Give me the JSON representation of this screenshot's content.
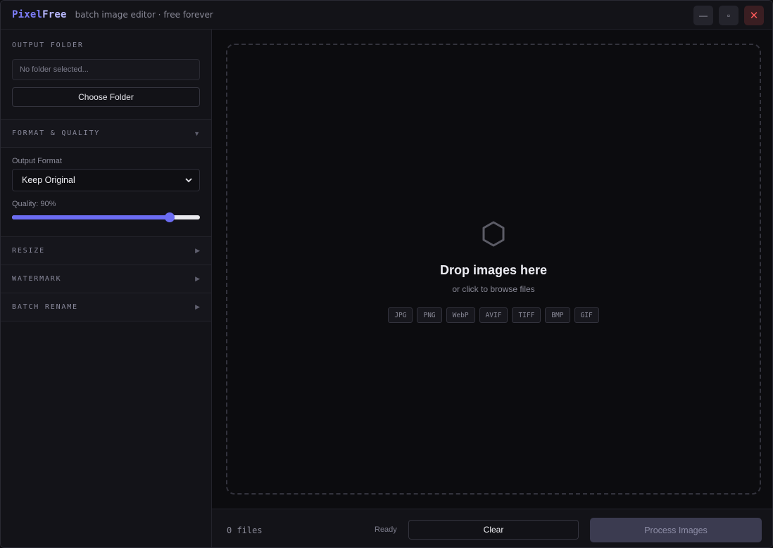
{
  "app": {
    "name_part1": "Pixel",
    "name_part2": "Free",
    "tagline": "batch image editor · free forever"
  },
  "window_controls": {
    "minimize": "—",
    "maximize": "▫",
    "close": "✕"
  },
  "sidebar": {
    "output_folder": {
      "label": "OUTPUT FOLDER",
      "placeholder": "No folder selected...",
      "button": "Choose Folder"
    },
    "format_quality": {
      "label": "FORMAT & QUALITY",
      "arrow": "▼",
      "expanded": true,
      "output_format_label": "Output Format",
      "output_format_value": "Keep Original",
      "quality_label": "Quality: 90%",
      "quality_fraction": 0.84
    },
    "sections": [
      {
        "label": "RESIZE",
        "arrow": "▶"
      },
      {
        "label": "WATERMARK",
        "arrow": "▶"
      },
      {
        "label": "BATCH RENAME",
        "arrow": "▶"
      }
    ]
  },
  "dropzone": {
    "icon": "hexagon-icon",
    "title": "Drop images here",
    "subtitle": "or click to browse files",
    "formats": [
      "JPG",
      "PNG",
      "WebP",
      "AVIF",
      "TIFF",
      "BMP",
      "GIF"
    ]
  },
  "footer": {
    "file_count": "0 files",
    "status": "Ready",
    "clear_label": "Clear",
    "process_label": "Process Images"
  },
  "colors": {
    "accent": "#6b6cf2",
    "brand_primary": "#7c7cf8",
    "close_red": "#ff5a5a"
  }
}
